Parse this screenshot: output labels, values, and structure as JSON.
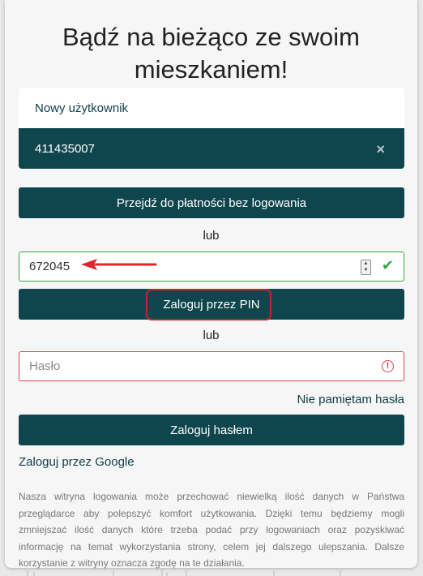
{
  "header": {
    "title": "Bądź na bieżąco ze swoim mieszkaniem!"
  },
  "users": {
    "new_user": "Nowy użytkownik",
    "selected_user": "411435007",
    "remove_icon": "×"
  },
  "actions": {
    "pay_without_login": "Przejdź do płatności bez logowania",
    "or_1": "lub",
    "pin_value": "672045",
    "login_pin": "Zaloguj przez PIN",
    "or_2": "lub",
    "password_placeholder": "Hasło",
    "forgot_password": "Nie pamiętam hasła",
    "login_password": "Zaloguj hasłem",
    "login_google": "Zaloguj przez Google"
  },
  "notice": "Nasza witryna logowania może przechować niewielką ilość danych w Państwa przeglądarce aby polepszyć komfort użytkowania. Dzięki temu będziemy mogli zmniejszać ilość danych które trzeba podać przy logowaniach oraz pozyskiwać informację na temat wykorzystania strony, celem jej dalszego ulepszania. Dalsze korzystanie z witryny oznacza zgodę na te działania.",
  "icons": {
    "check": "check-icon",
    "alert": "alert-circle-icon",
    "arrow": "red-arrow-annotation",
    "spinner": "number-spinner-icon"
  },
  "colors": {
    "primary": "#0f464e",
    "success": "#3aa34b",
    "danger": "#d9434a",
    "annotation": "#e1262b"
  }
}
